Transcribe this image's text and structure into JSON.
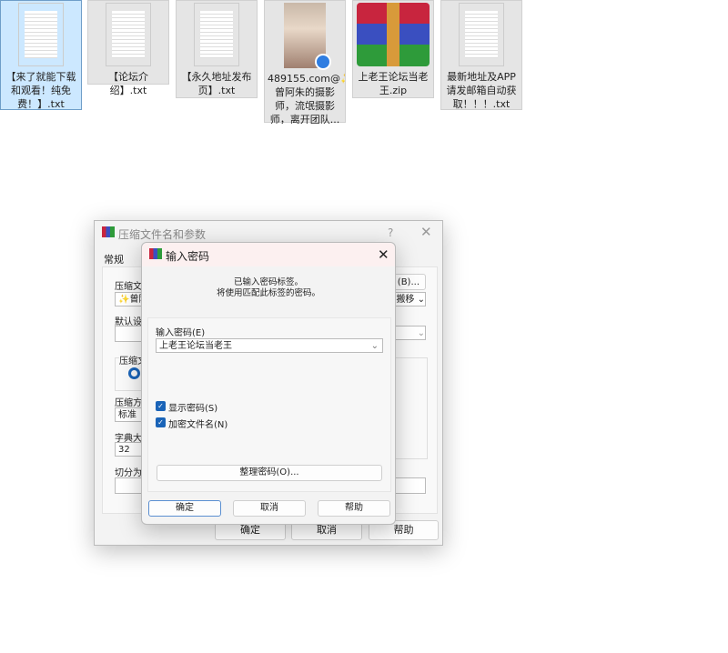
{
  "files": [
    {
      "name": "【来了就能下载和观看！纯免费！】.txt",
      "type": "txt",
      "selected": true
    },
    {
      "name": "【论坛介绍】.txt",
      "type": "txt"
    },
    {
      "name": "【永久地址发布页】.txt",
      "type": "txt"
    },
    {
      "name": "489155.com@✨曾阿朱的摄影师，流氓摄影师，离开团队...",
      "type": "image"
    },
    {
      "name": "上老王论坛当老王.zip",
      "type": "zip"
    },
    {
      "name": "最新地址及APP请发邮箱自动获取！！！.txt",
      "type": "txt"
    }
  ],
  "back_dialog": {
    "title": "压缩文件名和参数",
    "help_char": "?",
    "tab": "常规",
    "label_archive": "压缩文件",
    "archive_value": "✨曾阿",
    "browse": "(B)...",
    "label_default": "默认设置",
    "update_value": "搬移",
    "label_format": "压缩文件",
    "label_method": "压缩方式",
    "method_value": "标准",
    "label_dict": "字典大小",
    "dict_value": "32",
    "label_split": "切分为分",
    "ok": "确定",
    "cancel": "取消",
    "help": "帮助"
  },
  "password_dialog": {
    "title": "输入密码",
    "message_line1": "已输入密码标签。",
    "message_line2": "将使用匹配此标签的密码。",
    "password_label": "输入密码(E)",
    "password_value": "上老王论坛当老王",
    "show_password": {
      "label": "显示密码(S)",
      "checked": true
    },
    "encrypt_names": {
      "label": "加密文件名(N)",
      "checked": true
    },
    "organize": "整理密码(O)...",
    "ok": "确定",
    "cancel": "取消",
    "help": "帮助"
  }
}
